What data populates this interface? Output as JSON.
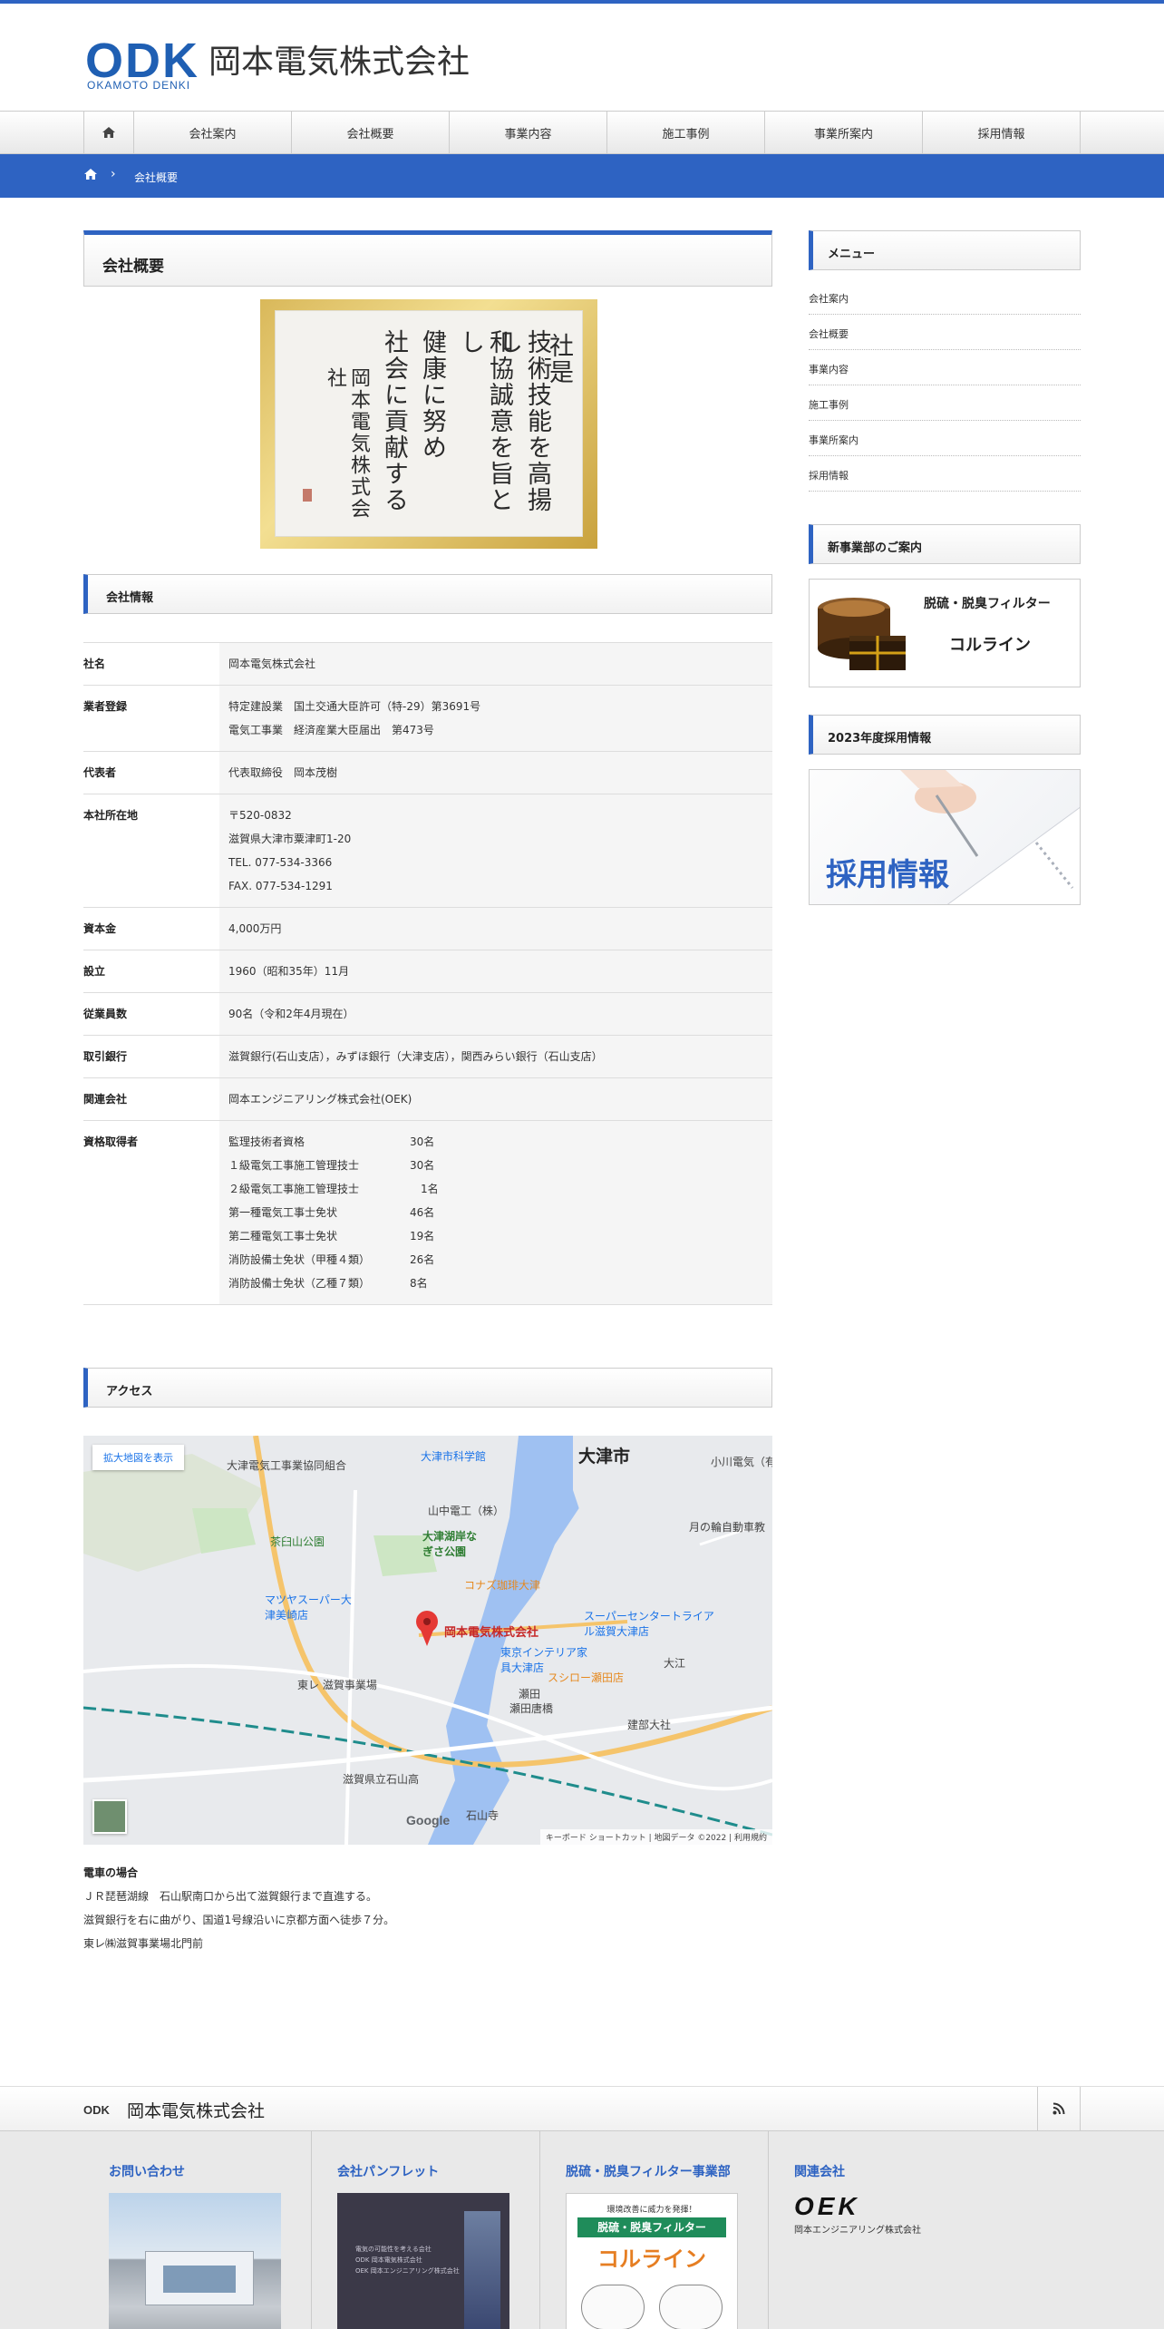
{
  "header": {
    "logo_mark": "ODK",
    "logo_sub": "OKAMOTO DENKI",
    "company_name": "岡本電気株式会社"
  },
  "nav": {
    "items": [
      "会社案内",
      "会社概要",
      "事業内容",
      "施工事例",
      "事業所案内",
      "採用情報"
    ]
  },
  "breadcrumb": {
    "current": "会社概要"
  },
  "page_title": "会社概要",
  "calligraphy": {
    "columns": [
      "社是",
      "技術技能を高揚し",
      "和協誠意を旨とし",
      "健康に努め",
      "社会に貢献する",
      "岡本電気株式会社"
    ]
  },
  "company_info": {
    "heading": "会社情報",
    "rows": [
      {
        "label": "社名",
        "lines": [
          "岡本電気株式会社"
        ]
      },
      {
        "label": "業者登録",
        "lines": [
          "特定建設業　国土交通大臣許可（特-29）第3691号",
          "電気工事業　経済産業大臣届出　第473号"
        ]
      },
      {
        "label": "代表者",
        "lines": [
          "代表取締役　岡本茂樹"
        ]
      },
      {
        "label": "本社所在地",
        "lines": [
          "〒520-0832",
          "滋賀県大津市粟津町1-20",
          "TEL. 077-534-3366",
          "FAX. 077-534-1291"
        ]
      },
      {
        "label": "資本金",
        "lines": [
          "4,000万円"
        ]
      },
      {
        "label": "設立",
        "lines": [
          "1960（昭和35年）11月"
        ]
      },
      {
        "label": "従業員数",
        "lines": [
          "90名（令和2年4月現在）"
        ]
      },
      {
        "label": "取引銀行",
        "lines": [
          "滋賀銀行(石山支店），みずほ銀行（大津支店），関西みらい銀行（石山支店）"
        ]
      },
      {
        "label": "関連会社",
        "lines": [
          "岡本エンジニアリング株式会社(OEK)"
        ]
      }
    ],
    "qualifications": {
      "label": "資格取得者",
      "items": [
        {
          "name": "監理技術者資格",
          "count": "30名"
        },
        {
          "name": "１級電気工事施工管理技士",
          "count": "30名"
        },
        {
          "name": "２級電気工事施工管理技士",
          "count": "　1名"
        },
        {
          "name": "第一種電気工事士免状",
          "count": "46名"
        },
        {
          "name": "第二種電気工事士免状",
          "count": "19名"
        },
        {
          "name": "消防設備士免状（甲種４類）",
          "count": "26名"
        },
        {
          "name": "消防設備士免状（乙種７類）",
          "count": "8名"
        }
      ]
    }
  },
  "access": {
    "heading": "アクセス",
    "map": {
      "enlarge_label": "拡大地図を表示",
      "labels": {
        "city": "大津市",
        "pin": "岡本電気株式会社",
        "p1": "大津電気工事業協同組合",
        "p2": "大津市科学館",
        "p3": "小川電気（有）",
        "p4": "山中電工（株）",
        "p5": "大津湖岸なぎさ公園",
        "p6": "茶臼山公園",
        "p7": "コナズ珈琲大津",
        "p8": "スーパーセンタートライアル滋賀大津店",
        "p9": "東京インテリア家具大津店",
        "p10": "スシロー瀬田店",
        "p11": "マツヤスーパー大津美崎店",
        "p12": "東レ 滋賀事業場",
        "p13": "建部大社",
        "p14": "滋賀県立石山高",
        "p15": "石山寺",
        "p16": "瀬田唐橋",
        "p17": "月の輪自動車教",
        "p18": "大江",
        "p19": "瀬田"
      },
      "footer": "キーボード ショートカット | 地図データ ©2022 | 利用規約",
      "google": "Google"
    },
    "train_heading": "電車の場合",
    "lines": [
      "ＪＲ琵琶湖線　石山駅南口から出て滋賀銀行まで直進する。",
      "滋賀銀行を右に曲がり、国道1号線沿いに京都方面へ徒歩７分。",
      "東レ㈱滋賀事業場北門前"
    ]
  },
  "sidebar": {
    "menu_heading": "メニュー",
    "menu": [
      "会社案内",
      "会社概要",
      "事業内容",
      "施工事例",
      "事業所案内",
      "採用情報"
    ],
    "new_business_heading": "新事業部のご案内",
    "filter_banner": {
      "line1": "脱硫・脱臭フィルター",
      "line2": "コルライン"
    },
    "recruit_heading": "2023年度採用情報",
    "recruit_banner": "採用情報"
  },
  "footer": {
    "logo_mark": "ODK",
    "company_name": "岡本電気株式会社",
    "widgets": [
      {
        "title": "お問い合わせ"
      },
      {
        "title": "会社パンフレット",
        "pamphlet_lines": [
          "電気の可能性を考える会社",
          "ODK 岡本電気株式会社",
          "OEK 岡本エンジニアリング株式会社"
        ]
      },
      {
        "title": "脱硫・脱臭フィルター事業部",
        "flyer_top": "環境改善に威力を発揮！",
        "flyer_band": "脱硫・脱臭フィルター",
        "flyer_name": "コルライン"
      },
      {
        "title": "関連会社",
        "oek_mark": "OEK",
        "oek_name": "岡本エンジニアリング株式会社"
      }
    ]
  },
  "colors": {
    "accent": "#2e63c2",
    "table_cell_bg": "#f5f5f5",
    "footer_bg": "#e9e9e9"
  }
}
